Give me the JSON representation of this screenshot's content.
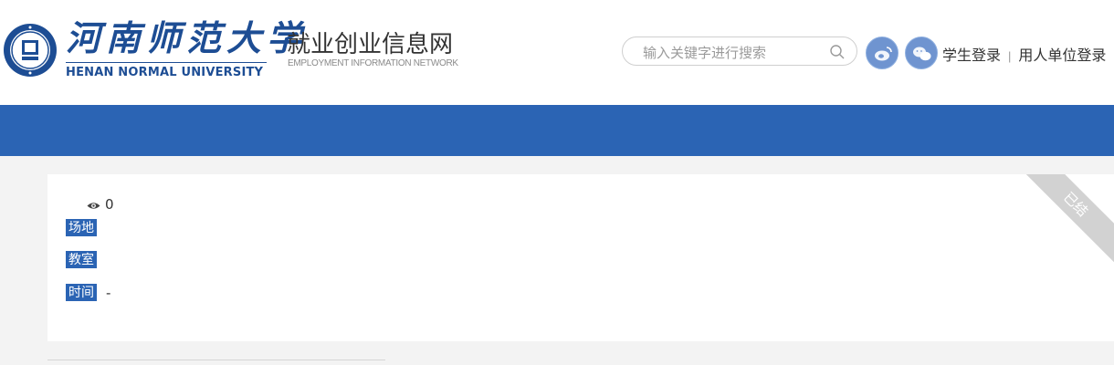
{
  "header": {
    "logo": {
      "cn": "河南师范大学",
      "en": "HENAN NORMAL UNIVERSITY"
    },
    "site_title": "就业创业信息网",
    "site_subtitle": "EMPLOYMENT INFORMATION NETWORK",
    "search": {
      "placeholder": "输入关键字进行搜索"
    },
    "social": [
      "weibo-icon",
      "wechat-icon"
    ],
    "login": {
      "student": "学生登录",
      "separator": "|",
      "employer": "用人单位登录"
    }
  },
  "detail": {
    "views": "0",
    "rows": [
      {
        "label": "场地",
        "value": ""
      },
      {
        "label": "教室",
        "value": ""
      },
      {
        "label": "时间",
        "value": "-"
      }
    ],
    "corner_badge": "已结"
  },
  "colors": {
    "brand_blue": "#2b64b4",
    "logo_blue": "#1d4d94",
    "background": "#f3f3f3"
  }
}
